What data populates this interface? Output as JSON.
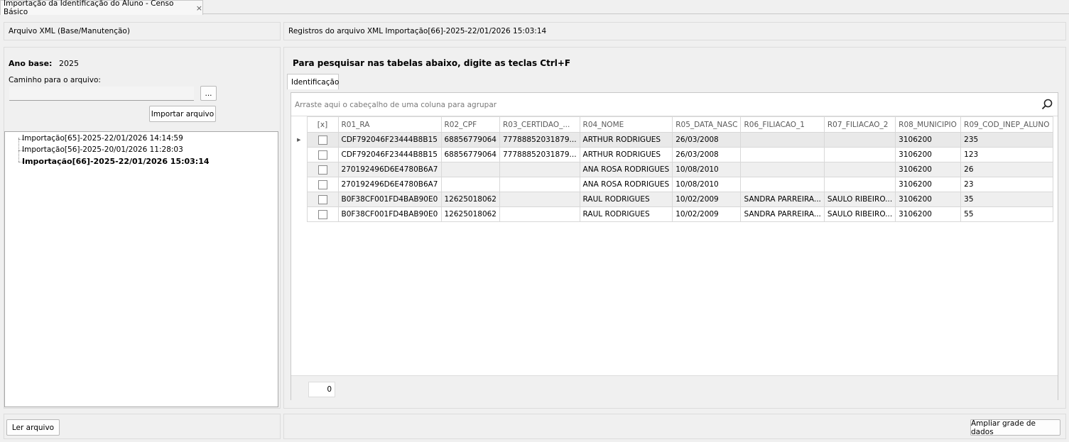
{
  "tab": {
    "title": "Importação da Identificação do Aluno - Censo Básico",
    "close": "×"
  },
  "left_panel": {
    "header": "Arquivo XML (Base/Manutenção)",
    "ano_base_label": "Ano base:",
    "ano_base_value": "2025",
    "path_label": "Caminho para o arquivo:",
    "path_value": "",
    "browse_label": "...",
    "import_button": "Importar arquivo",
    "tree_items": [
      {
        "label": "Importação[65]-2025-22/01/2026 14:14:59",
        "bold": false
      },
      {
        "label": "Importação[56]-2025-20/01/2026 11:28:03",
        "bold": false
      },
      {
        "label": "Importação[66]-2025-22/01/2026 15:03:14",
        "bold": true
      }
    ],
    "read_button": "Ler arquivo"
  },
  "right_panel": {
    "header": "Registros do arquivo XML Importação[66]-2025-22/01/2026 15:03:14",
    "hint": "Para pesquisar nas tabelas abaixo, digite as teclas Ctrl+F",
    "tab_label": "Identificação",
    "group_hint": "Arraste aqui o cabeçalho de uma coluna para agrupar",
    "columns": [
      "[x]",
      "R01_RA",
      "R02_CPF",
      "R03_CERTIDAO_...",
      "R04_NOME",
      "R05_DATA_NASC",
      "R06_FILIACAO_1",
      "R07_FILIACAO_2",
      "R08_MUNICIPIO",
      "R09_COD_INEP_ALUNO"
    ],
    "rows": [
      [
        "CDF792046F23444B8B15",
        "68856779064",
        "77788852031879...",
        "ARTHUR RODRIGUES",
        "26/03/2008",
        "",
        "",
        "3106200",
        "235"
      ],
      [
        "CDF792046F23444B8B15",
        "68856779064",
        "77788852031879...",
        "ARTHUR RODRIGUES",
        "26/03/2008",
        "",
        "",
        "3106200",
        "123"
      ],
      [
        "270192496D6E4780B6A7",
        "",
        "",
        "ANA ROSA RODRIGUES",
        "10/08/2010",
        "",
        "",
        "3106200",
        "26"
      ],
      [
        "270192496D6E4780B6A7",
        "",
        "",
        "ANA ROSA RODRIGUES",
        "10/08/2010",
        "",
        "",
        "3106200",
        "23"
      ],
      [
        "B0F38CF001FD4BAB90E0",
        "12625018062",
        "",
        "RAUL RODRIGUES",
        "10/02/2009",
        "SANDRA PARREIRA...",
        "SAULO RIBEIRO...",
        "3106200",
        "35"
      ],
      [
        "B0F38CF001FD4BAB90E0",
        "12625018062",
        "",
        "RAUL RODRIGUES",
        "10/02/2009",
        "SANDRA PARREIRA...",
        "SAULO RIBEIRO...",
        "3106200",
        "55"
      ]
    ],
    "row_indicator": "▸",
    "footer_count": "0",
    "expand_button": "Ampliar grade de dados"
  }
}
